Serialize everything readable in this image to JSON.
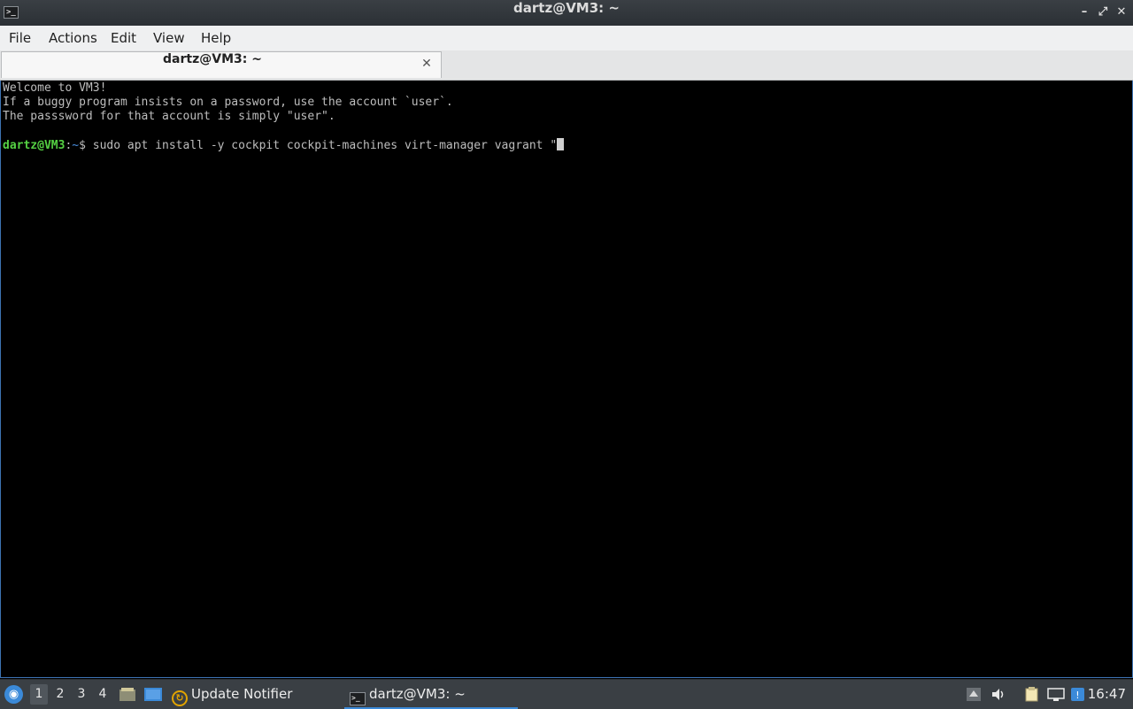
{
  "window": {
    "title": "dartz@VM3: ~",
    "app_icon_glyph": ">_",
    "controls": {
      "minimize": "–",
      "maximize": "⤢",
      "close": "✕"
    }
  },
  "menubar": {
    "items": [
      "File",
      "Actions",
      "Edit",
      "View",
      "Help"
    ]
  },
  "tabs": [
    {
      "label": "dartz@VM3: ~",
      "close_glyph": "✕"
    }
  ],
  "terminal": {
    "lines": [
      "Welcome to VM3!",
      "If a buggy program insists on a password, use the account `user`.",
      "The passsword for that account is simply \"user\"."
    ],
    "prompt_user": "dartz@VM3",
    "prompt_sep": ":",
    "prompt_dir": "~",
    "prompt_symbol": "$",
    "command": " sudo apt install -y cockpit cockpit-machines virt-manager vagrant \""
  },
  "taskbar": {
    "workspaces": [
      "1",
      "2",
      "3",
      "4"
    ],
    "active_workspace": "1",
    "tasks": [
      {
        "label": "Update Notifier",
        "icon": "update-notifier-icon"
      },
      {
        "label": "dartz@VM3: ~",
        "icon": "terminal-icon"
      }
    ],
    "clock": "16:47"
  },
  "colors": {
    "prompt_user": "#55d143",
    "prompt_dir": "#4a8fe0",
    "accent": "#3b8ad9"
  }
}
